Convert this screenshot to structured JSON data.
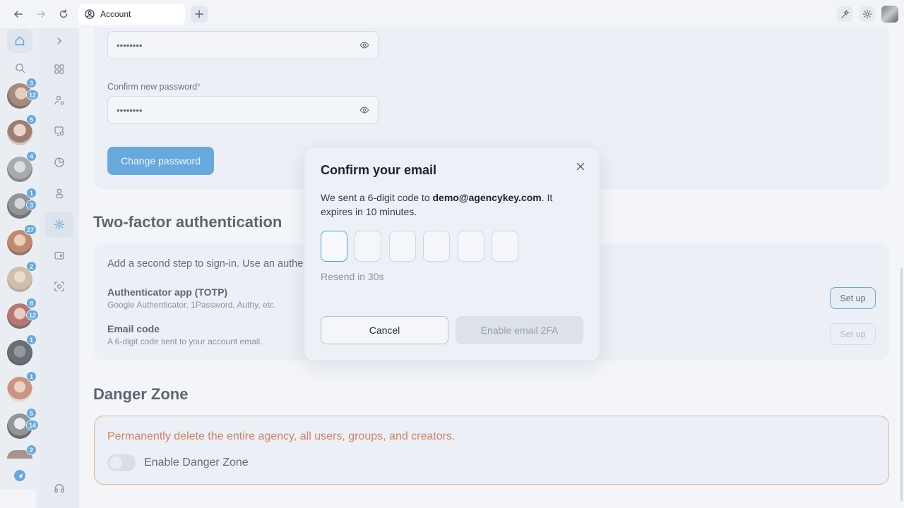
{
  "browser": {
    "tab_title": "Account",
    "icons": [
      "back-arrow-icon",
      "forward-arrow-icon",
      "reload-icon",
      "plus-icon",
      "sparkle-icon",
      "gear-icon"
    ]
  },
  "rail": {
    "badges": [
      {
        "top": "3",
        "bottom": "12"
      },
      {
        "top": "5",
        "bottom": null
      },
      {
        "top": "4",
        "bottom": null
      },
      {
        "top": "1",
        "bottom": "3"
      },
      {
        "top": "27",
        "bottom": null
      },
      {
        "top": "2",
        "bottom": null
      },
      {
        "top": "8",
        "bottom": "12"
      },
      {
        "top": "1",
        "bottom": null
      },
      {
        "top": "1",
        "bottom": null
      },
      {
        "top": "5",
        "bottom": "14"
      },
      {
        "top": "2",
        "bottom": null
      }
    ]
  },
  "password": {
    "new_value": "••••••••",
    "confirm_label": "Confirm new password",
    "required_mark": "*",
    "confirm_value": "••••••••",
    "change_button": "Change password"
  },
  "two_factor": {
    "title": "Two-factor authentication",
    "intro": "Add a second step to sign-in. Use an authe",
    "methods": [
      {
        "title": "Authenticator app (TOTP)",
        "description": "Google Authenticator, 1Password, Authy, etc.",
        "button": "Set up"
      },
      {
        "title": "Email code",
        "description": "A 6-digit code sent to your account email.",
        "button": "Set up"
      }
    ]
  },
  "danger_zone": {
    "title": "Danger Zone",
    "description": "Permanently delete the entire agency, all users, groups, and creators.",
    "toggle_label": "Enable Danger Zone",
    "toggle_on": false
  },
  "modal": {
    "title": "Confirm your email",
    "text_before": "We sent a 6-digit code to ",
    "email": "demo@agencykey.com",
    "text_after": ". It expires in 10 minutes.",
    "code_digits": [
      "",
      "",
      "",
      "",
      "",
      ""
    ],
    "resend": "Resend in 30s",
    "cancel_button": "Cancel",
    "enable_button": "Enable email 2FA"
  },
  "colors": {
    "accent": "#2a8ad6",
    "danger_border": "#ef9a5a",
    "danger_text": "#c0531c"
  }
}
